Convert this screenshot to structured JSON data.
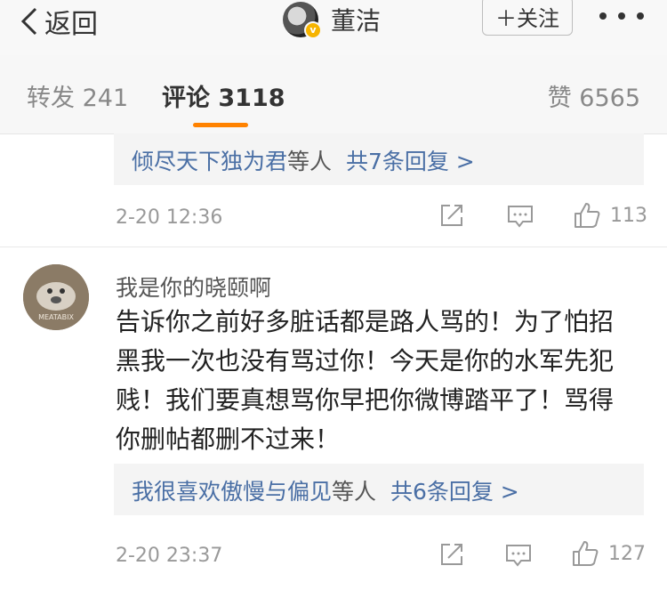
{
  "nav": {
    "back_label": "返回",
    "profile_name": "董洁",
    "follow_label": "＋关注"
  },
  "tabs": {
    "repost": "转发 241",
    "comment": "评论 3118",
    "like": "赞 6565"
  },
  "comments": [
    {
      "reply_names": "倾尽天下独为君",
      "reply_others": "等人",
      "reply_count": "共7条回复 >",
      "time": "2-20 12:36",
      "likes": "113"
    },
    {
      "username": "我是你的晓颐啊",
      "avatar_text": "MEATABIX",
      "content": "告诉你之前好多脏话都是路人骂的！为了怕招黑我一次也没有骂过你！今天是你的水军先犯贱！我们要真想骂你早把你微博踏平了！骂得你删帖都删不过来！",
      "reply_names": "我很喜欢傲慢与偏见",
      "reply_others": "等人",
      "reply_count": "共6条回复 >",
      "time": "2-20 23:37",
      "likes": "127"
    }
  ],
  "icons": {
    "back": "chevron-left-icon",
    "verified": "verified-badge-icon",
    "more": "more-dots-icon",
    "repost": "repost-icon",
    "comment": "comment-icon",
    "like": "thumbs-up-icon"
  },
  "colors": {
    "accent": "#ff8200",
    "link": "#4a6fa5",
    "verified": "#f6b400"
  }
}
